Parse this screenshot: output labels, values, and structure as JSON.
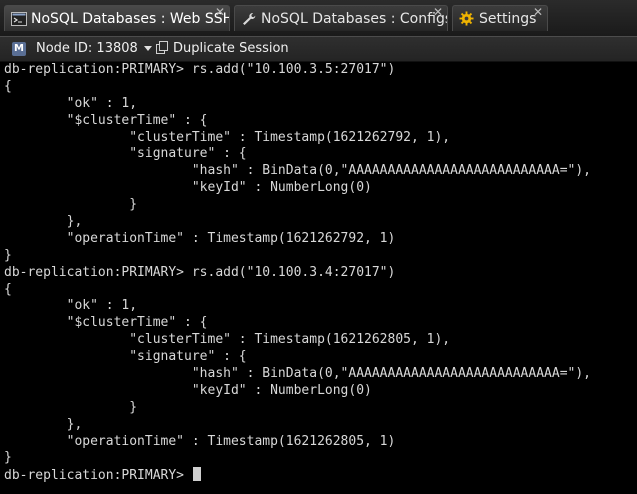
{
  "tabs": [
    {
      "label": "NoSQL Databases : Web SSH",
      "icon": "terminal-icon",
      "close": "✕",
      "active": true
    },
    {
      "label": "NoSQL Databases : Configs",
      "icon": "wrench-icon",
      "close": "✕",
      "active": false
    },
    {
      "label": "Settings",
      "icon": "gear-icon",
      "close": "✕",
      "active": false
    }
  ],
  "toolbar": {
    "node_badge": "M",
    "node_label": "Node ID: 13808",
    "duplicate_label": "Duplicate Session"
  },
  "terminal": {
    "lines": [
      "db-replication:PRIMARY> rs.add(\"10.100.3.5:27017\")",
      "{",
      "        \"ok\" : 1,",
      "        \"$clusterTime\" : {",
      "                \"clusterTime\" : Timestamp(1621262792, 1),",
      "                \"signature\" : {",
      "                        \"hash\" : BinData(0,\"AAAAAAAAAAAAAAAAAAAAAAAAAAA=\"),",
      "                        \"keyId\" : NumberLong(0)",
      "                }",
      "        },",
      "        \"operationTime\" : Timestamp(1621262792, 1)",
      "}",
      "db-replication:PRIMARY> rs.add(\"10.100.3.4:27017\")",
      "{",
      "        \"ok\" : 1,",
      "        \"$clusterTime\" : {",
      "                \"clusterTime\" : Timestamp(1621262805, 1),",
      "                \"signature\" : {",
      "                        \"hash\" : BinData(0,\"AAAAAAAAAAAAAAAAAAAAAAAAAAA=\"),",
      "                        \"keyId\" : NumberLong(0)",
      "                }",
      "        },",
      "        \"operationTime\" : Timestamp(1621262805, 1)",
      "}"
    ],
    "prompt": "db-replication:PRIMARY> "
  },
  "colors": {
    "terminal_bg": "#000000",
    "terminal_fg": "#d8d8d8",
    "gear_accent": "#f0b400"
  }
}
